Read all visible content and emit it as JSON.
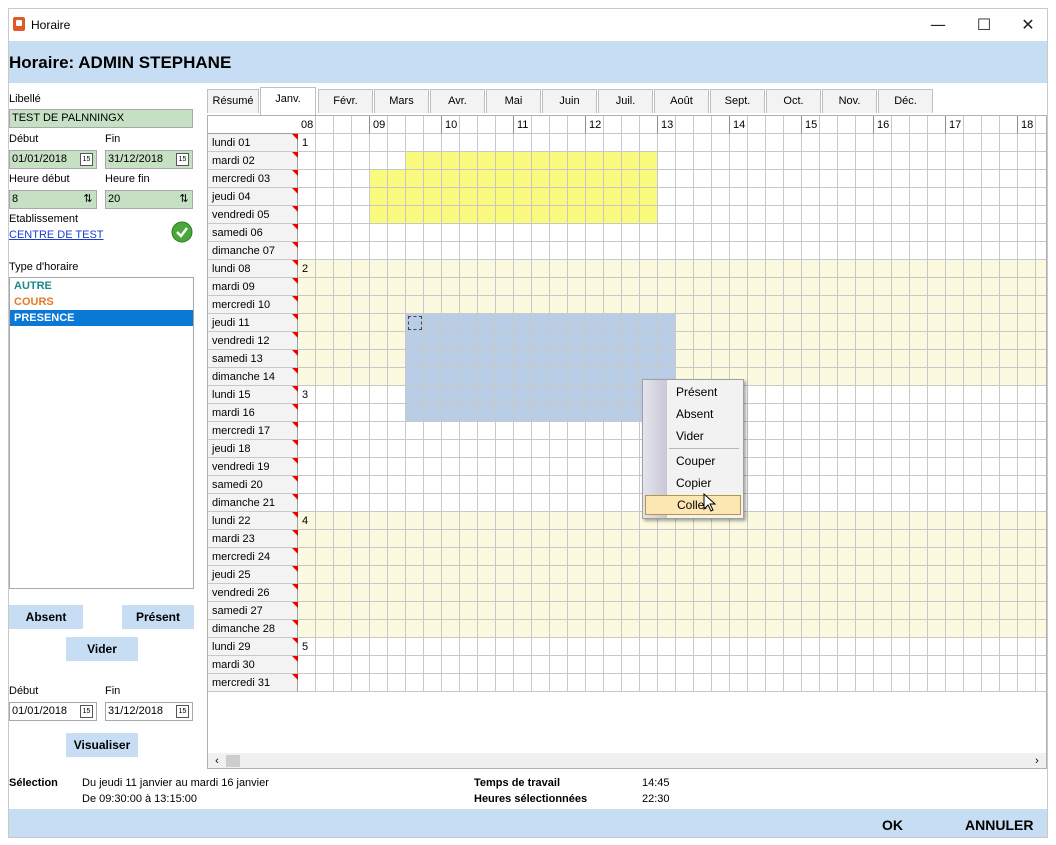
{
  "window": {
    "title": "Horaire",
    "minimize": "—",
    "maximize": "☐",
    "close": "✕"
  },
  "header": {
    "title": "Horaire: ADMIN STEPHANE"
  },
  "form": {
    "libelle_label": "Libellé",
    "libelle_value": "TEST DE PALNNINGX",
    "debut_label": "Début",
    "debut_value": "01/01/2018",
    "fin_label": "Fin",
    "fin_value": "31/12/2018",
    "heure_debut_label": "Heure début",
    "heure_debut_value": "8",
    "heure_fin_label": "Heure fin",
    "heure_fin_value": "20",
    "etablissement_label": "Etablissement",
    "etablissement_value": "CENTRE DE TEST",
    "type_label": "Type d'horaire",
    "types": [
      {
        "label": "AUTRE",
        "color": "#1a8a8a",
        "selected": false
      },
      {
        "label": "COURS",
        "color": "#e57a2b",
        "selected": false
      },
      {
        "label": "PRESENCE",
        "color": "#ffffff",
        "selected": true
      }
    ],
    "btn_absent": "Absent",
    "btn_present": "Présent",
    "btn_vider": "Vider",
    "view_debut_label": "Début",
    "view_debut_value": "01/01/2018",
    "view_fin_label": "Fin",
    "view_fin_value": "31/12/2018",
    "btn_visualiser": "Visualiser",
    "cal_icon_text": "15"
  },
  "tabs": [
    "Résumé",
    "Janv.",
    "Févr.",
    "Mars",
    "Avr.",
    "Mai",
    "Juin",
    "Juil.",
    "Août",
    "Sept.",
    "Oct.",
    "Nov.",
    "Déc."
  ],
  "active_tab": 1,
  "grid": {
    "hours": [
      "08",
      "09",
      "10",
      "11",
      "12",
      "13",
      "14",
      "15",
      "16",
      "17",
      "18"
    ],
    "days": [
      "lundi 01",
      "mardi 02",
      "mercredi 03",
      "jeudi 04",
      "vendredi 05",
      "samedi 06",
      "dimanche 07",
      "lundi 08",
      "mardi 09",
      "mercredi 10",
      "jeudi 11",
      "vendredi 12",
      "samedi 13",
      "dimanche 14",
      "lundi 15",
      "mardi 16",
      "mercredi 17",
      "jeudi 18",
      "vendredi 19",
      "samedi 20",
      "dimanche 21",
      "lundi 22",
      "mardi 23",
      "mercredi 24",
      "jeudi 25",
      "vendredi 26",
      "samedi 27",
      "dimanche 28",
      "lundi 29",
      "mardi 30",
      "mercredi 31"
    ],
    "week_numbers": [
      {
        "row": 0,
        "num": "1"
      },
      {
        "row": 7,
        "num": "2"
      },
      {
        "row": 14,
        "num": "3"
      },
      {
        "row": 21,
        "num": "4"
      },
      {
        "row": 28,
        "num": "5"
      }
    ],
    "colors": {
      "present": "#fafa7e",
      "week_band": "#fbfae0",
      "selection": "#b9cde6",
      "border": "#c8c8c8"
    },
    "present_blocks": [
      {
        "days": [
          1,
          1
        ],
        "from": "09:30",
        "to": "13:00"
      },
      {
        "days": [
          2,
          4
        ],
        "from": "09:00",
        "to": "13:00"
      }
    ],
    "week_bands": [
      [
        7,
        13
      ],
      [
        21,
        27
      ]
    ],
    "selection": {
      "days": [
        10,
        15
      ],
      "from": "09:30",
      "to": "13:15"
    }
  },
  "context_menu": {
    "items": [
      "Présent",
      "Absent",
      "Vider",
      "Couper",
      "Copier",
      "Coller"
    ],
    "highlighted": 5
  },
  "status": {
    "selection_label": "Sélection",
    "selection_line1": "Du jeudi 11 janvier au mardi 16 janvier",
    "selection_line2": "De 09:30:00 à 13:15:00",
    "travail_label": "Temps de travail",
    "travail_value": "14:45",
    "heures_label": "Heures sélectionnées",
    "heures_value": "22:30"
  },
  "footer": {
    "ok": "OK",
    "annuler": "ANNULER"
  },
  "scroll": {
    "left": "‹",
    "right": "›"
  }
}
